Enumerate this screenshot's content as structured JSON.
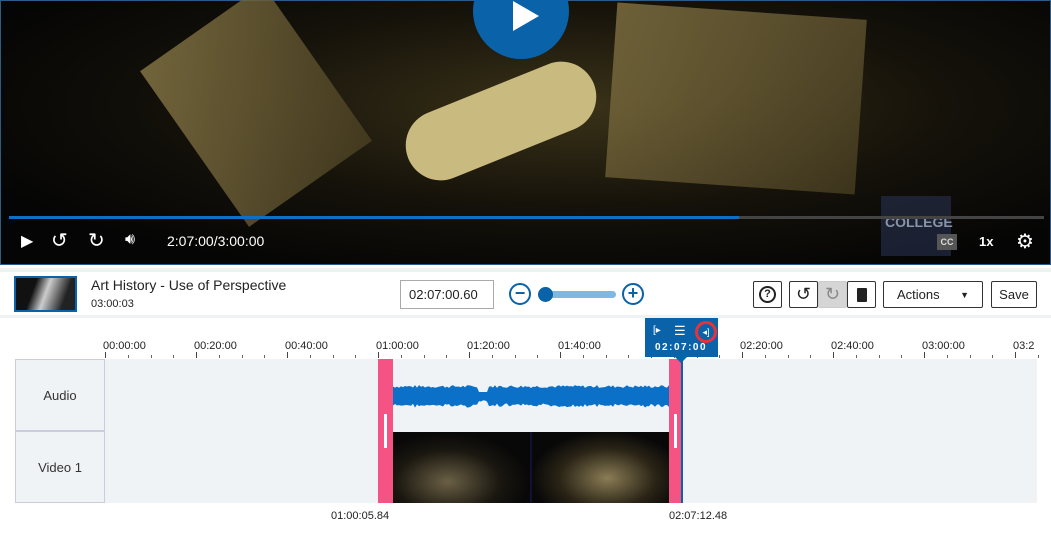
{
  "player": {
    "time_display": "2:07:00/3:00:00",
    "progress_fraction": 0.7056,
    "speed_label": "1x",
    "cc_label": "CC",
    "watermark": "COLLEGE",
    "accent": "#0a62a8"
  },
  "media": {
    "title": "Art History - Use of Perspective",
    "duration": "03:00:03"
  },
  "toolbar": {
    "time_input": "02:07:00.60",
    "zoom_level_fraction": 0.0,
    "actions_label": "Actions",
    "save_label": "Save"
  },
  "timeline": {
    "ticks": [
      "00:00:00",
      "00:20:00",
      "00:40:00",
      "01:00:00",
      "01:20:00",
      "01:40:00",
      "02:00:00",
      "02:20:00",
      "02:40:00",
      "03:00:00",
      "03:2"
    ],
    "playhead_time": "02:07:00",
    "tracks": [
      "Audio",
      "Video 1"
    ],
    "selection_start": "01:00:05.84",
    "selection_end": "02:07:12.48",
    "handle_color": "#f45383"
  }
}
